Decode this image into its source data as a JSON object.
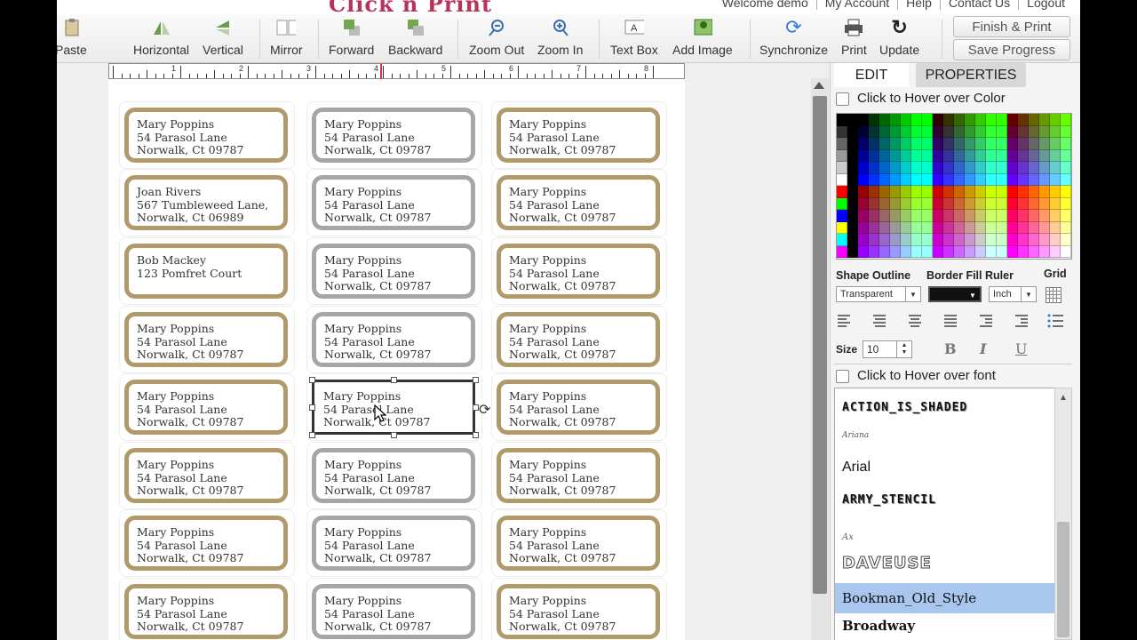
{
  "header": {
    "logo": "Click n Print",
    "links": [
      "Welcome demo",
      "My Account",
      "Help",
      "Contact Us",
      "Logout"
    ]
  },
  "toolbar": {
    "items": [
      {
        "label": "Paste",
        "icon": "paste-icon"
      },
      {
        "label": "Horizontal",
        "icon": "flip-horizontal-icon"
      },
      {
        "label": "Vertical",
        "icon": "flip-vertical-icon"
      },
      {
        "label": "Mirror",
        "icon": "mirror-icon"
      },
      {
        "label": "Forward",
        "icon": "bring-forward-icon"
      },
      {
        "label": "Backward",
        "icon": "send-backward-icon"
      },
      {
        "label": "Zoom Out",
        "icon": "zoom-out-icon"
      },
      {
        "label": "Zoom In",
        "icon": "zoom-in-icon"
      },
      {
        "label": "Text Box",
        "icon": "text-box-icon"
      },
      {
        "label": "Add Image",
        "icon": "add-image-icon"
      },
      {
        "label": "Synchronize",
        "icon": "synchronize-icon"
      },
      {
        "label": "Print",
        "icon": "print-icon"
      },
      {
        "label": "Update",
        "icon": "update-icon"
      }
    ],
    "finish_print": "Finish & Print",
    "save_progress": "Save Progress"
  },
  "ruler": {
    "numbers": [
      "1",
      "2",
      "3",
      "4",
      "5",
      "6",
      "7",
      "8"
    ]
  },
  "labels": {
    "default": [
      "Mary Poppins",
      "54 Parasol Lane",
      "Norwalk, Ct 09787"
    ],
    "joan": [
      "Joan Rivers",
      "567 Tumbleweed Lane,",
      "Norwalk, Ct 06989"
    ],
    "bob": [
      "Bob Mackey",
      "123 Pomfret Court",
      ""
    ]
  },
  "panel": {
    "tabs": {
      "edit": "EDIT",
      "properties": "PROPERTIES"
    },
    "hover_color": "Click to Hover over Color",
    "shape_outline": "Shape Outline",
    "border_fill_ruler": "Border Fill Ruler",
    "grid": "Grid",
    "outline_value": "Transparent",
    "ruler_unit": "Inch",
    "size_label": "Size",
    "size_value": "10",
    "bold": "B",
    "italic": "I",
    "underline": "U",
    "hover_font": "Click to Hover over font",
    "fonts": [
      "ACTION_IS_SHADED",
      "Ariana",
      "Arial",
      "ARMY_STENCIL",
      "Ax",
      "DAVEUSE",
      "Bookman_Old_Style",
      "Broadway"
    ],
    "selected_font": "Bookman_Old_Style"
  }
}
